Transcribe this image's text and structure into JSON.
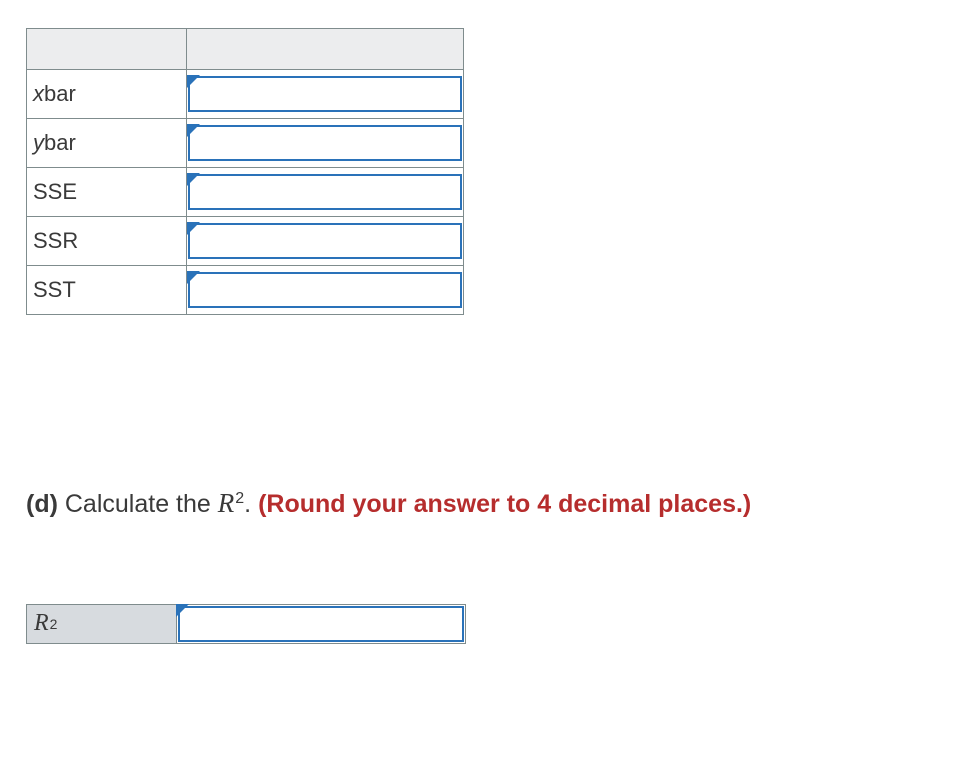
{
  "table": {
    "rows": [
      {
        "label_html": "<span class=\"italic-x\">x</span>bar",
        "label_plain": "xbar",
        "value": ""
      },
      {
        "label_html": "<span class=\"italic-y\">y</span>bar",
        "label_plain": "ybar",
        "value": ""
      },
      {
        "label_html": "SSE",
        "label_plain": "SSE",
        "value": ""
      },
      {
        "label_html": "SSR",
        "label_plain": "SSR",
        "value": ""
      },
      {
        "label_html": "SST",
        "label_plain": "SST",
        "value": ""
      }
    ]
  },
  "prompt": {
    "part_label": "(d)",
    "text_before_symbol": " Calculate the ",
    "symbol_html": "<span class=\"Rsym\">R</span><sup>2</sup>",
    "period_after_symbol": ". ",
    "red_text": "(Round your answer to 4 decimal places.)"
  },
  "r2": {
    "label_html": "<span class=\"Rsym\">R</span><sup>2</sup>",
    "label_plain": "R2",
    "value": ""
  }
}
